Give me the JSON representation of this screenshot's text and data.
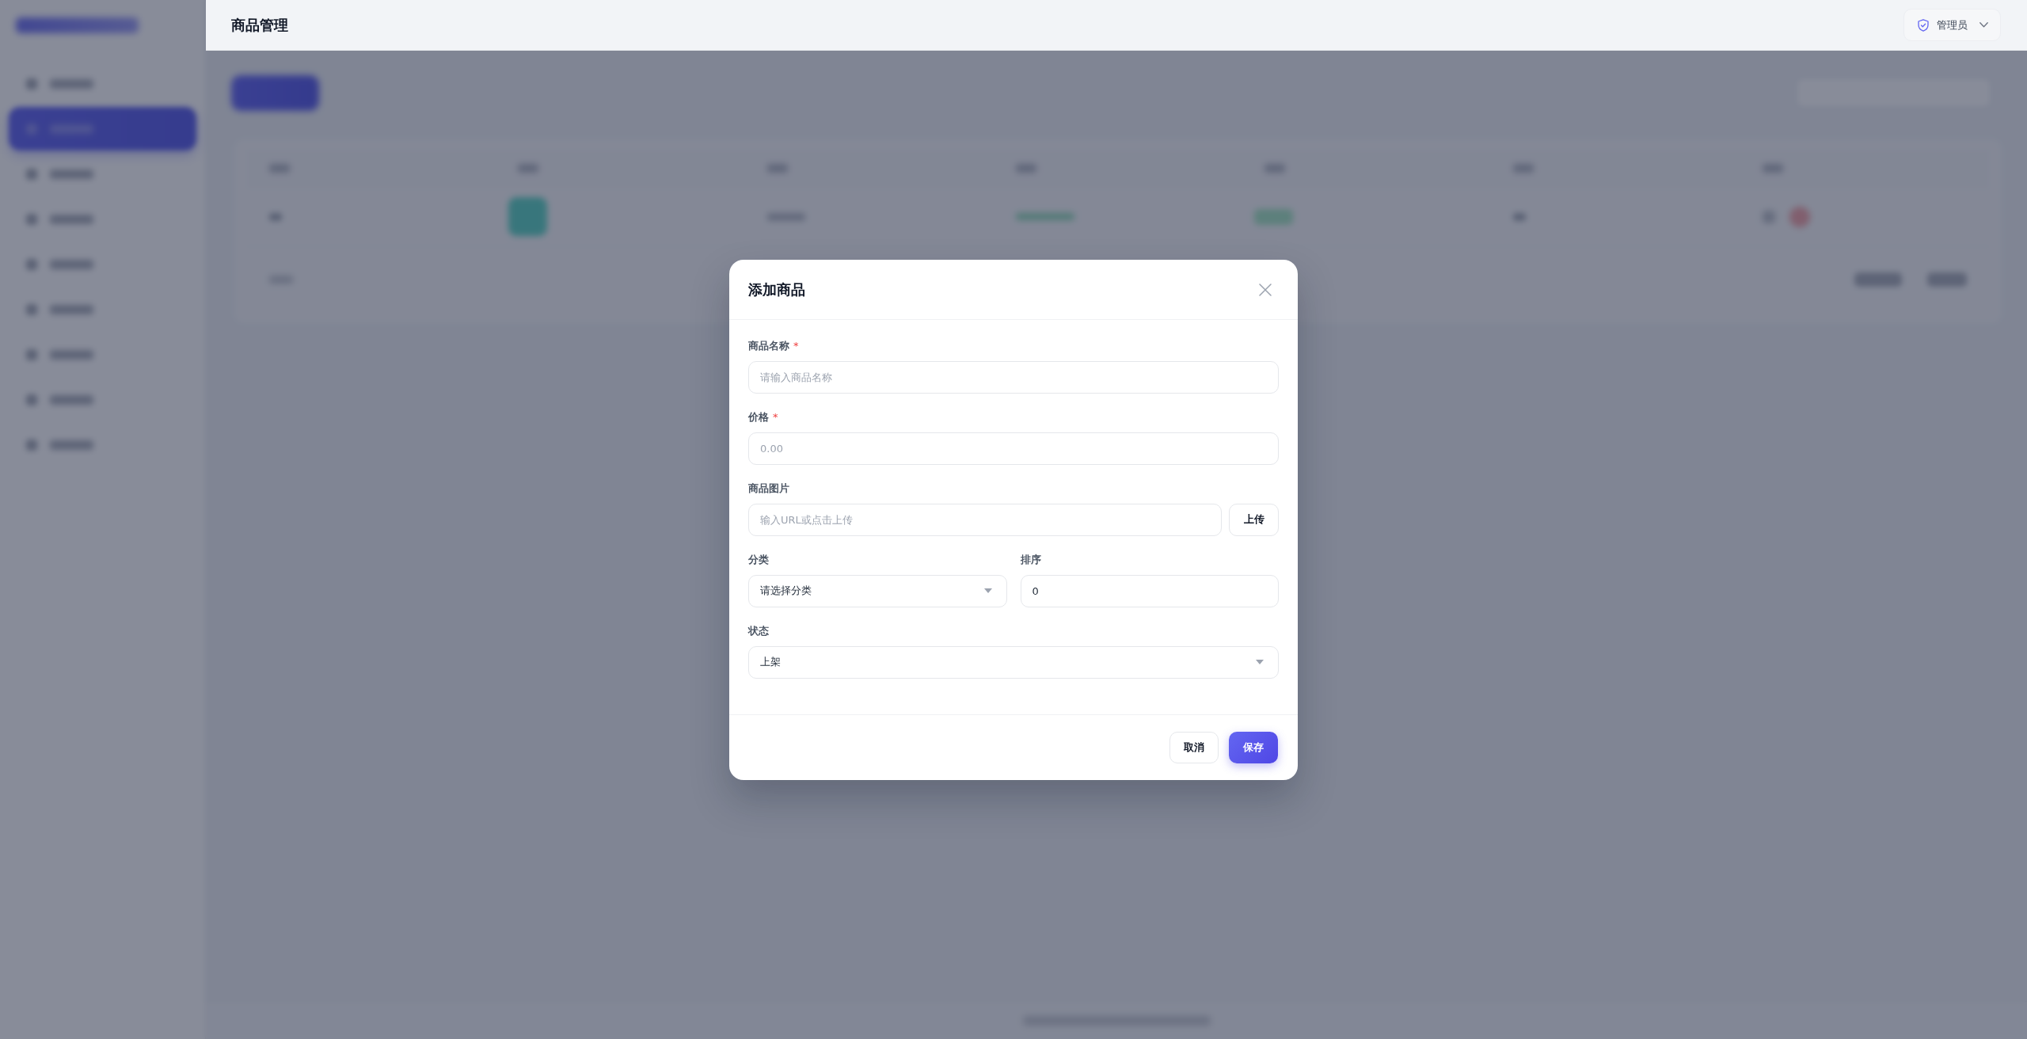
{
  "header": {
    "title": "商品管理",
    "user_menu": {
      "label": "管理员"
    }
  },
  "sidebar": {
    "items": [
      {
        "selected": false
      },
      {
        "selected": true
      },
      {
        "selected": false
      },
      {
        "selected": false
      },
      {
        "selected": false
      },
      {
        "selected": false
      },
      {
        "selected": false
      },
      {
        "selected": false
      },
      {
        "selected": false
      }
    ]
  },
  "dialog": {
    "title": "添加商品",
    "rows": [
      {
        "fields": [
          {
            "kind": "text",
            "label": "商品名称",
            "required_mark": "*",
            "placeholder": "请输入商品名称"
          }
        ]
      },
      {
        "fields": [
          {
            "kind": "text",
            "label": "价格",
            "required_mark": "*",
            "placeholder": "0.00"
          }
        ]
      },
      {
        "fields": [
          {
            "kind": "upload",
            "label": "商品图片",
            "placeholder": "输入URL或点击上传",
            "button": "上传"
          }
        ]
      },
      {
        "fields": [
          {
            "kind": "select",
            "label": "分类",
            "value": "请选择分类"
          },
          {
            "kind": "text",
            "label": "排序",
            "value": "0"
          }
        ]
      },
      {
        "fields": [
          {
            "kind": "select",
            "label": "状态",
            "value": "上架"
          }
        ]
      }
    ],
    "buttons": [
      {
        "kind": "secondary",
        "label": "取消"
      },
      {
        "kind": "primary",
        "label": "保存"
      }
    ]
  }
}
